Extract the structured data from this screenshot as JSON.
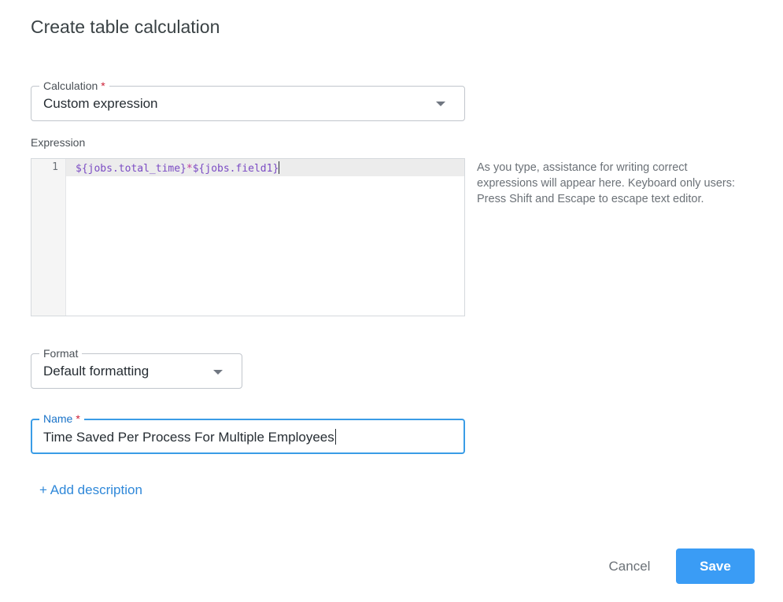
{
  "dialog": {
    "title": "Create table calculation"
  },
  "calculation": {
    "label": "Calculation",
    "required_marker": "*",
    "value": "Custom expression"
  },
  "expression": {
    "label": "Expression",
    "line_number": "1",
    "code_part1": "${jobs.total_time}",
    "code_operator": "*",
    "code_part2": "${jobs.field1}",
    "help_text": "As you type, assistance for writing correct expressions will appear here. Keyboard only users: Press Shift and Escape to escape text editor."
  },
  "format": {
    "label": "Format",
    "value": "Default formatting"
  },
  "name": {
    "label": "Name",
    "required_marker": "*",
    "value": "Time Saved Per Process For Multiple Employees"
  },
  "actions": {
    "add_description": "+ Add description",
    "cancel": "Cancel",
    "save": "Save"
  },
  "colors": {
    "accent": "#3a9cf5",
    "focus_border": "#3a9ce6",
    "required": "#cc1f36",
    "code_field": "#7b4bc4",
    "code_operator": "#c13d9e"
  },
  "icons": {
    "dropdown": "chevron-down-icon"
  }
}
